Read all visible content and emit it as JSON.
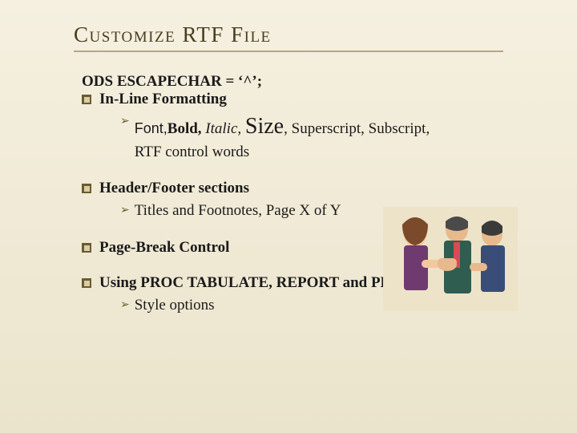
{
  "title": "Customize RTF File",
  "escapechar_line": "ODS ESCAPECHAR = ‘^’;",
  "bullets": {
    "inline_formatting": "In-Line Formatting",
    "header_footer": "Header/Footer sections",
    "page_break": "Page-Break Control",
    "using_procs": "Using PROC TABULATE, REPORT and PRINT"
  },
  "inline_sub": {
    "font": "Font,",
    "bold": "Bold,",
    "italic": "Italic,",
    "size": "Size",
    "rest": ", Superscript, Subscript,",
    "line2": "RTF control words"
  },
  "header_sub": "Titles and Footnotes, Page X of Y",
  "procs_sub": "Style options"
}
